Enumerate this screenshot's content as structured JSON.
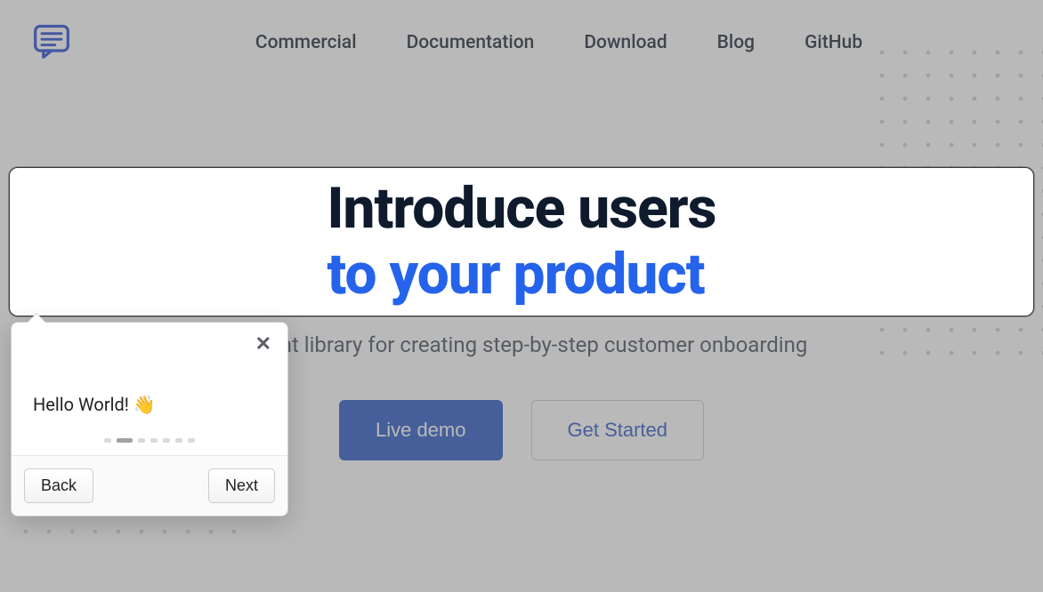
{
  "nav": {
    "items": [
      {
        "label": "Commercial"
      },
      {
        "label": "Documentation"
      },
      {
        "label": "Download"
      },
      {
        "label": "Blog"
      },
      {
        "label": "GitHub"
      }
    ]
  },
  "hero": {
    "headline_line1": "Introduce users",
    "headline_line2": "to your product",
    "subtitle_visible": "weight library for creating step-by-step customer onboarding",
    "cta_primary": "Live demo",
    "cta_secondary": "Get Started"
  },
  "popover": {
    "message": "Hello World! 👋",
    "back_label": "Back",
    "next_label": "Next",
    "total_steps": 7,
    "active_step_index": 1
  },
  "colors": {
    "accent": "#2563eb",
    "primary_button": "#2f5bc7",
    "text_dark": "#0f1b2d"
  }
}
